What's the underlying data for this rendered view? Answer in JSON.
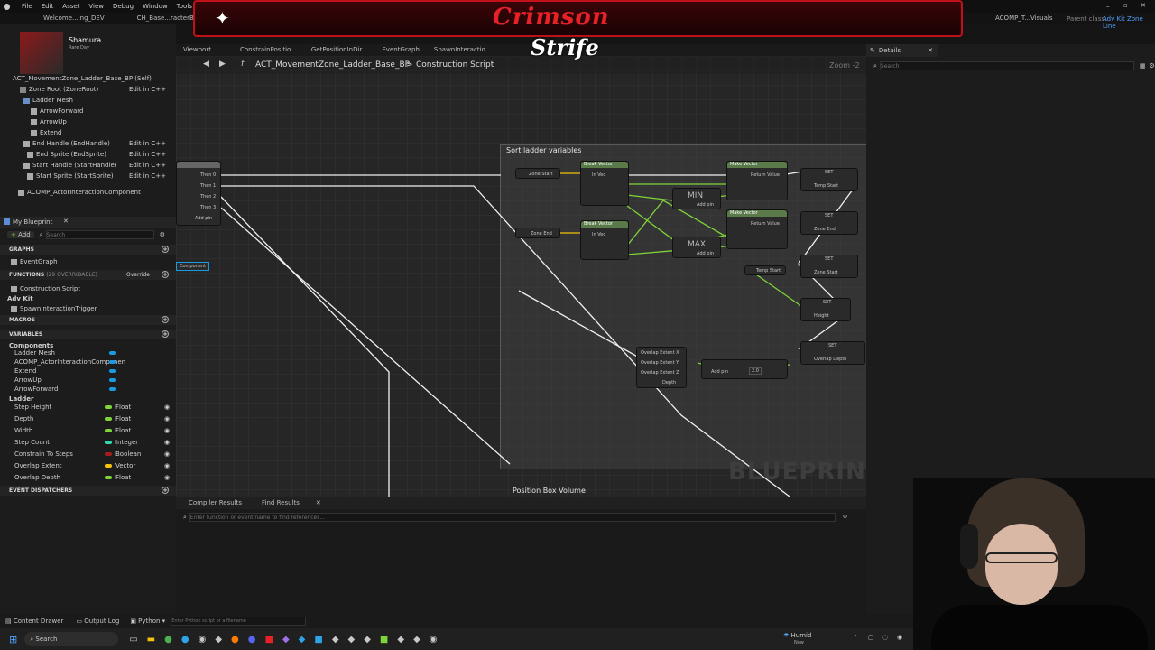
{
  "menu": [
    "File",
    "Edit",
    "Asset",
    "View",
    "Debug",
    "Window",
    "Tools"
  ],
  "tabs": [
    "Welcome...ing_DEV",
    "CH_Base...racterBP"
  ],
  "banner": {
    "title": "Crimson",
    "subtitle": "Strife"
  },
  "right_top": {
    "tab": "ACOMP_T...Visuals",
    "parent_label": "Parent class:",
    "parent_value": "Adv Kit Zone Line"
  },
  "streamer": {
    "name": "Shamura",
    "sub": "Rare Day"
  },
  "components_tree": [
    {
      "label": "ACT_MovementZone_Ladder_Base_BP (Self)",
      "edit": ""
    },
    {
      "label": "Zone Root (ZoneRoot)",
      "edit": "Edit in C++"
    },
    {
      "label": "Ladder Mesh",
      "edit": ""
    },
    {
      "label": "ArrowForward",
      "edit": ""
    },
    {
      "label": "ArrowUp",
      "edit": ""
    },
    {
      "label": "Extend",
      "edit": ""
    },
    {
      "label": "End Handle (EndHandle)",
      "edit": "Edit in C++"
    },
    {
      "label": "End Sprite (EndSprite)",
      "edit": "Edit in C++"
    },
    {
      "label": "Start Handle (StartHandle)",
      "edit": "Edit in C++"
    },
    {
      "label": "Start Sprite (StartSprite)",
      "edit": "Edit in C++"
    },
    {
      "label": "ACOMP_ActorInteractionComponent",
      "edit": ""
    }
  ],
  "my_blueprint": {
    "title": "My Blueprint",
    "add": "Add",
    "search_placeholder": "Search",
    "graphs_hdr": "GRAPHS",
    "event_graph": "EventGraph",
    "functions_hdr": "FUNCTIONS",
    "functions_count": "(29 OVERRIDABLE)",
    "override": "Override",
    "functions": [
      "Construction Script"
    ],
    "adv_kit": "Adv Kit",
    "adv_kit_items": [
      "SpawnInteractionTrigger"
    ],
    "macros_hdr": "MACROS",
    "variables_hdr": "VARIABLES",
    "components_hdr": "Components",
    "components": [
      "Ladder Mesh",
      "ACOMP_ActorInteractionComponen",
      "Extend",
      "ArrowUp",
      "ArrowForward"
    ],
    "ladder_hdr": "Ladder",
    "ladder_vars": [
      {
        "name": "Step Height",
        "type": "Float",
        "color": "#7fd43a"
      },
      {
        "name": "Depth",
        "type": "Float",
        "color": "#7fd43a"
      },
      {
        "name": "Width",
        "type": "Float",
        "color": "#7fd43a"
      },
      {
        "name": "Step Count",
        "type": "Integer",
        "color": "#2fd9b0"
      },
      {
        "name": "Constrain To Steps",
        "type": "Boolean",
        "color": "#a51c1c"
      },
      {
        "name": "Overlap Extent",
        "type": "Vector",
        "color": "#f2c20d"
      },
      {
        "name": "Overlap Depth",
        "type": "Float",
        "color": "#7fd43a"
      }
    ],
    "event_dispatchers_hdr": "EVENT DISPATCHERS"
  },
  "graph_tabs": [
    "Viewport",
    "ConstrainPositio...",
    "GetPositionInDir...",
    "EventGraph",
    "SpawnInteractio..."
  ],
  "breadcrumb": {
    "blueprint": "ACT_MovementZone_Ladder_Base_BP",
    "sep": ">",
    "graph": "Construction Script",
    "zoom": "Zoom -2"
  },
  "comments": {
    "sort": "Sort ladder variables",
    "position": "Position Box Volume"
  },
  "nodes": {
    "sequence_pins": [
      "Then 0",
      "Then 1",
      "Then 2",
      "Then 3",
      "Add pin"
    ],
    "zone_start": "Zone Start",
    "zone_end": "Zone End",
    "break_vector": "Break Vector",
    "in_vec": "In Vec",
    "make_vector": "Make Vector",
    "return_value": "Return Value",
    "min": "MIN",
    "max": "MAX",
    "add_pin": "Add pin",
    "set": "SET",
    "temp_start": "Temp Start",
    "zone_start_pin": "Zone Start",
    "zone_end_pin": "Zone End",
    "height": "Height",
    "overlap_depth": "Overlap Depth",
    "overlap_extent_x": "Overlap Extent X",
    "overlap_extent_y": "Overlap Extent Y",
    "overlap_extent_z": "Overlap Extent Z",
    "depth": "Depth",
    "mult_value": "2.0",
    "component": "Component"
  },
  "watermark": "BLUEPRINT",
  "bottom": {
    "tabs": [
      "Compiler Results",
      "Find Results"
    ],
    "placeholder": "Enter function or event name to find references..."
  },
  "details": {
    "title": "Details",
    "search_placeholder": "Search"
  },
  "statusbar": {
    "content_drawer": "Content Drawer",
    "output_log": "Output Log",
    "python": "Python",
    "cmd_placeholder": "Enter Python script or a filename"
  },
  "taskbar": {
    "search": "Search",
    "weather": "Humid",
    "weather_sub": "Now"
  }
}
